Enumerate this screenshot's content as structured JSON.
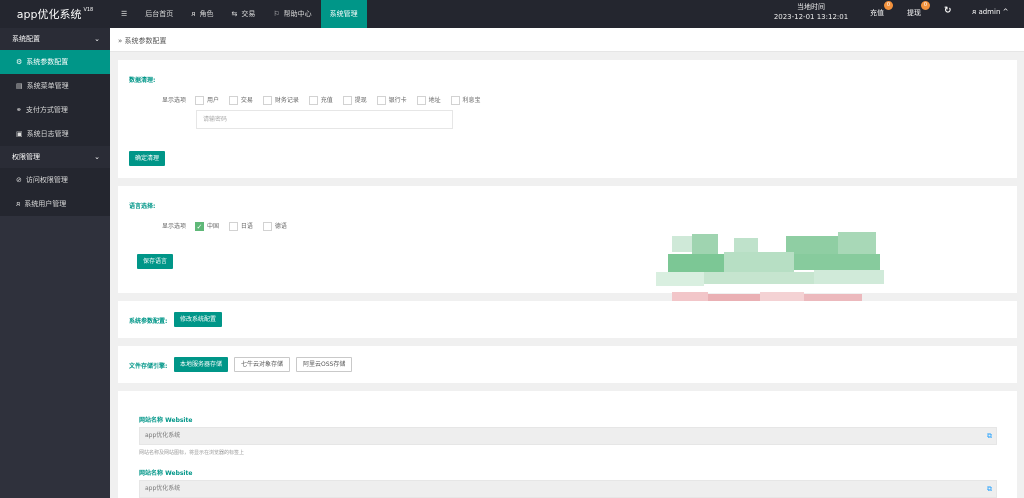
{
  "app": {
    "title": "app优化系统",
    "version": "V18"
  },
  "topnav": {
    "menu_icon": "menu-icon",
    "items": [
      {
        "label": "后台首页",
        "icon": ""
      },
      {
        "label": "角色",
        "icon": "user-icon"
      },
      {
        "label": "交易",
        "icon": "exchange-icon"
      },
      {
        "label": "帮助中心",
        "icon": "flag-icon"
      },
      {
        "label": "系统管理",
        "icon": "",
        "active": true
      }
    ]
  },
  "header": {
    "time_label": "当地时间",
    "time_value": "2023-12-01 13:12:01",
    "recharge": {
      "label": "充值",
      "badge": "0"
    },
    "withdraw": {
      "label": "提现",
      "badge": "0"
    },
    "refresh_icon": "refresh-icon",
    "user": {
      "name": "admin",
      "caret": "^"
    }
  },
  "sidebar": {
    "groups": [
      {
        "label": "系统配置",
        "caret": "v",
        "items": [
          {
            "label": "系统参数配置",
            "icon": "gear-icon",
            "active": true
          },
          {
            "label": "系统菜单管理",
            "icon": "window-icon"
          },
          {
            "label": "支付方式管理",
            "icon": "link-icon"
          },
          {
            "label": "系统日志管理",
            "icon": "file-icon"
          }
        ]
      },
      {
        "label": "权限管理",
        "caret": "v",
        "items": [
          {
            "label": "访问权限管理",
            "icon": "shield-icon"
          },
          {
            "label": "系统用户管理",
            "icon": "user-icon"
          }
        ]
      }
    ]
  },
  "breadcrumb": "系统参数配置",
  "data_select": {
    "title": "数据清理:",
    "option_label": "显示选项",
    "options": [
      "用户",
      "交易",
      "财务记录",
      "充值",
      "提现",
      "银行卡",
      "地址",
      "利息宝"
    ],
    "input_placeholder": "请输密码",
    "button": "确定清理"
  },
  "language": {
    "title": "语言选择:",
    "option_label": "显示选项",
    "options": [
      {
        "label": "中国",
        "checked": true
      },
      {
        "label": "日语",
        "checked": false
      },
      {
        "label": "德语",
        "checked": false
      }
    ],
    "button": "保存语言"
  },
  "params": {
    "label": "系统参数配置:",
    "button": "修改系统配置"
  },
  "storage": {
    "label": "文件存储引擎:",
    "buttons": [
      {
        "label": "本地服务器存储",
        "active": true
      },
      {
        "label": "七牛云对象存储",
        "active": false
      },
      {
        "label": "阿里云OSS存储",
        "active": false
      }
    ]
  },
  "website": {
    "fields": [
      {
        "label": "网站名称 Website",
        "value": "app优化系统",
        "hint": "网站名称及网站图标，将显示在浏览器的标签上"
      },
      {
        "label": "网站名称 Website",
        "value": "app优化系统",
        "hint": ""
      }
    ]
  },
  "colors": {
    "accent": "#009688",
    "topbar": "#24262f",
    "sidebar": "#2f313c",
    "badge": "#f2913c"
  }
}
